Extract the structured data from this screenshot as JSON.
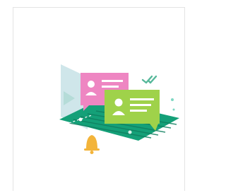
{
  "card": {
    "illustration": {
      "subject": "chat-messages-illustration",
      "colors": {
        "platform": "#14a078",
        "platform_lines": "#0f7f5f",
        "pink_card": "#ee86c2",
        "green_card": "#9fd24a",
        "back_panel": "#cfe6ea",
        "bell": "#f3b43a",
        "check": "#56b89a",
        "accent_dot": "#7ed7c3"
      }
    }
  }
}
